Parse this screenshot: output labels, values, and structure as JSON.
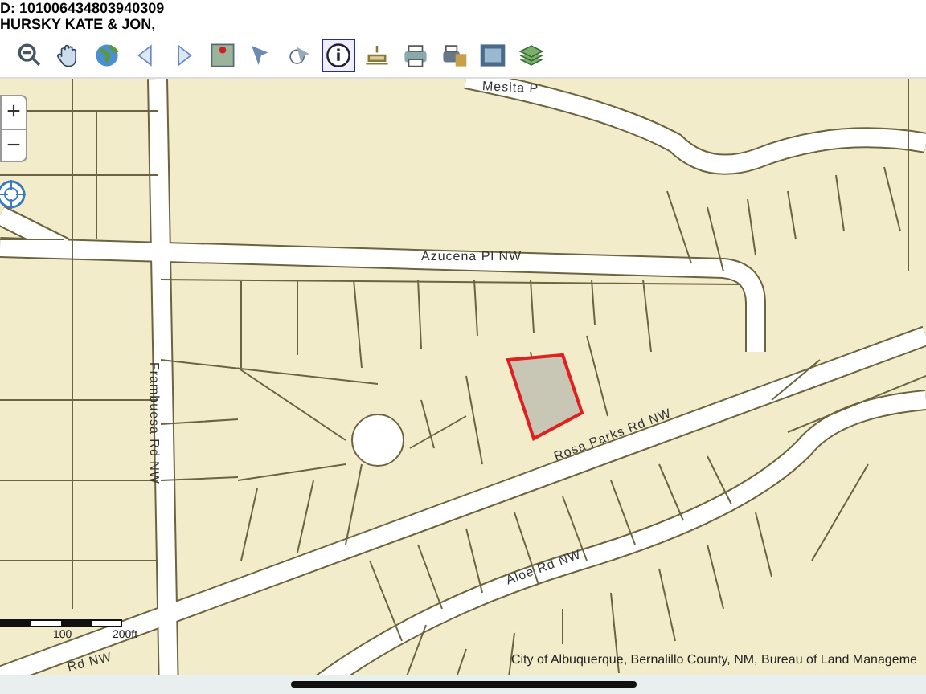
{
  "header": {
    "lines": [
      "D: 101006434803940309",
      "HURSKY KATE & JON,"
    ]
  },
  "toolbar": {
    "tools": [
      {
        "kind": "zoom-out",
        "selected": false
      },
      {
        "kind": "pan",
        "selected": false
      },
      {
        "kind": "globe",
        "selected": false
      },
      {
        "kind": "back",
        "selected": false
      },
      {
        "kind": "forward",
        "selected": false
      },
      {
        "kind": "map",
        "selected": false
      },
      {
        "kind": "pointer",
        "selected": false
      },
      {
        "kind": "select",
        "selected": false
      },
      {
        "kind": "info",
        "selected": true
      },
      {
        "kind": "measure",
        "selected": false
      },
      {
        "kind": "print",
        "selected": false
      },
      {
        "kind": "print-color",
        "selected": false
      },
      {
        "kind": "screen",
        "selected": false
      },
      {
        "kind": "layers",
        "selected": false
      }
    ]
  },
  "map": {
    "zoom_in": "+",
    "zoom_out": "−",
    "roads": [
      {
        "label": "Mesita P"
      },
      {
        "label": "Azucena Pl NW"
      },
      {
        "label": "Frambuesa Rd NW"
      },
      {
        "label": "Rosa Parks Rd NW"
      },
      {
        "label": "Aloe Rd NW"
      },
      {
        "label": "Rd NW"
      }
    ],
    "scale": {
      "labels": [
        "100",
        "200ft"
      ]
    },
    "attribution": "City of Albuquerque, Bernalillo County, NM, Bureau of Land Manageme"
  }
}
